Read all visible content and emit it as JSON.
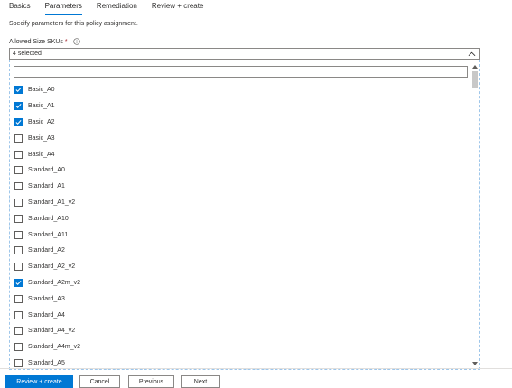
{
  "tabs": [
    {
      "label": "Basics",
      "active": false
    },
    {
      "label": "Parameters",
      "active": true
    },
    {
      "label": "Remediation",
      "active": false
    },
    {
      "label": "Review + create",
      "active": false
    }
  ],
  "description": "Specify parameters for this policy assignment.",
  "field": {
    "label": "Allowed Size SKUs",
    "required_marker": "*",
    "selected_text": "4 selected",
    "filter_value": ""
  },
  "items": [
    {
      "label": "Basic_A0",
      "checked": true
    },
    {
      "label": "Basic_A1",
      "checked": true
    },
    {
      "label": "Basic_A2",
      "checked": true
    },
    {
      "label": "Basic_A3",
      "checked": false
    },
    {
      "label": "Basic_A4",
      "checked": false
    },
    {
      "label": "Standard_A0",
      "checked": false
    },
    {
      "label": "Standard_A1",
      "checked": false
    },
    {
      "label": "Standard_A1_v2",
      "checked": false
    },
    {
      "label": "Standard_A10",
      "checked": false
    },
    {
      "label": "Standard_A11",
      "checked": false
    },
    {
      "label": "Standard_A2",
      "checked": false
    },
    {
      "label": "Standard_A2_v2",
      "checked": false
    },
    {
      "label": "Standard_A2m_v2",
      "checked": true
    },
    {
      "label": "Standard_A3",
      "checked": false
    },
    {
      "label": "Standard_A4",
      "checked": false
    },
    {
      "label": "Standard_A4_v2",
      "checked": false
    },
    {
      "label": "Standard_A4m_v2",
      "checked": false
    },
    {
      "label": "Standard_A5",
      "checked": false
    }
  ],
  "footer": {
    "review_label": "Review + create",
    "cancel_label": "Cancel",
    "previous_label": "Previous",
    "next_label": "Next"
  },
  "colors": {
    "accent": "#0078d4",
    "required": "#a4262c",
    "border": "#8a8886"
  }
}
